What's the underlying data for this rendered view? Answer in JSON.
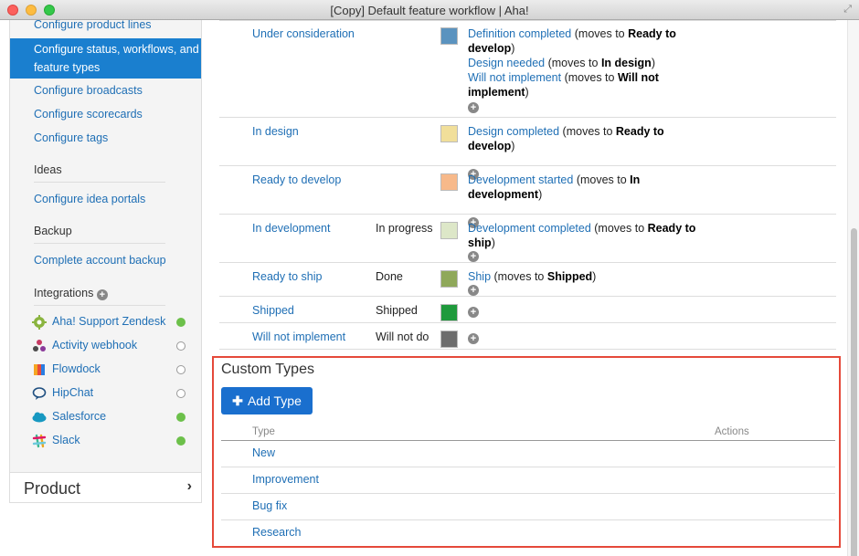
{
  "window": {
    "title": "[Copy] Default feature workflow | Aha!"
  },
  "sidebar": {
    "top_link": "Configure product lines",
    "active_item": "Configure status, workflows, and feature types",
    "links": [
      "Configure broadcasts",
      "Configure scorecards",
      "Configure tags"
    ],
    "ideas_heading": "Ideas",
    "ideas_link": "Configure idea portals",
    "backup_heading": "Backup",
    "backup_link": "Complete account backup",
    "integrations_heading": "Integrations",
    "integrations": [
      {
        "label": "Aha! Support Zendesk",
        "icon": "zendesk-icon",
        "enabled": true
      },
      {
        "label": "Activity webhook",
        "icon": "webhook-icon",
        "enabled": false
      },
      {
        "label": "Flowdock",
        "icon": "flowdock-icon",
        "enabled": false
      },
      {
        "label": "HipChat",
        "icon": "hipchat-icon",
        "enabled": false
      },
      {
        "label": "Salesforce",
        "icon": "salesforce-icon",
        "enabled": true
      },
      {
        "label": "Slack",
        "icon": "slack-icon",
        "enabled": true
      }
    ],
    "product_panel": "Product"
  },
  "workflow": {
    "statuses": [
      {
        "name": "Under consideration",
        "category": "",
        "color": "#5b93bf",
        "transitions": [
          {
            "action": "Definition completed",
            "prefix": " (moves to ",
            "target": "Ready to develop",
            "suffix": ")"
          },
          {
            "action": "Design needed",
            "prefix": " (moves to ",
            "target": "In design",
            "suffix": ")"
          },
          {
            "action": "Will not implement",
            "prefix": " (moves to ",
            "target": "Will not implement",
            "suffix": ")"
          }
        ]
      },
      {
        "name": "In design",
        "category": "",
        "color": "#f1df9a",
        "transitions": [
          {
            "action": "Design completed",
            "prefix": " (moves to ",
            "target": "Ready to develop",
            "suffix": ")"
          }
        ]
      },
      {
        "name": "Ready to develop",
        "category": "",
        "color": "#f7b98a",
        "transitions": [
          {
            "action": "Development started",
            "prefix": " (moves to ",
            "target": "In development",
            "suffix": ")"
          }
        ]
      },
      {
        "name": "In development",
        "category": "In progress",
        "color": "#dde7c8",
        "transitions": [
          {
            "action": "Development completed",
            "prefix": " (moves to ",
            "target": "Ready to ship",
            "suffix": ")"
          }
        ]
      },
      {
        "name": "Ready to ship",
        "category": "Done",
        "color": "#8fa85a",
        "transitions": [
          {
            "action": "Ship",
            "prefix": " (moves to ",
            "target": "Shipped",
            "suffix": ")"
          }
        ]
      },
      {
        "name": "Shipped",
        "category": "Shipped",
        "color": "#1f9a3c",
        "transitions": []
      },
      {
        "name": "Will not implement",
        "category": "Will not do",
        "color": "#6d6d6d",
        "transitions": []
      }
    ]
  },
  "custom_types": {
    "title": "Custom Types",
    "add_button": "Add Type",
    "col_type": "Type",
    "col_actions": "Actions",
    "types": [
      "New",
      "Improvement",
      "Bug fix",
      "Research"
    ]
  }
}
